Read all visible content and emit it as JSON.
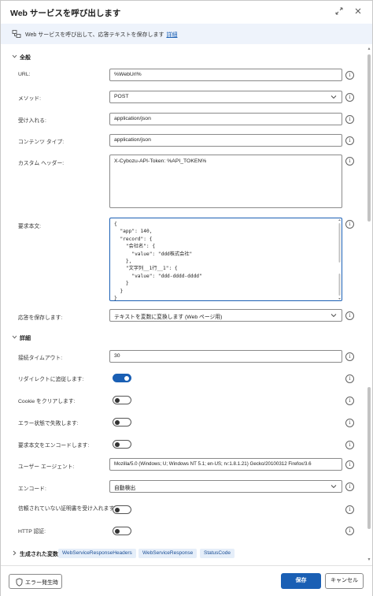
{
  "dialog": {
    "title": "Web サービスを呼び出します",
    "expand_icon": "expand-icon",
    "close_icon": "close-icon"
  },
  "info": {
    "text": "Web サービスを呼び出して、応答テキストを保存します",
    "link": "詳細"
  },
  "general": {
    "section_label": "全般",
    "url_label": "URL:",
    "url_value": "%WebUrl%",
    "method_label": "メソッド:",
    "method_value": "POST",
    "accept_label": "受け入れる:",
    "accept_value": "application/json",
    "content_type_label": "コンテンツ タイプ:",
    "content_type_value": "application/json",
    "custom_headers_label": "カスタム ヘッダー:",
    "custom_headers_value": "X-Cybozu-API-Token: %API_TOKEN%",
    "request_body_label": "要求本文:",
    "request_body_value": "{\n  \"app\": 140,\n  \"record\": {\n    \"会社名\": {\n      \"value\": \"ddd株式会社\"\n    },\n    \"文字列__1行__1\": {\n      \"value\": \"ddd-dddd-dddd\"\n    }\n  }\n}",
    "save_response_label": "応答を保存します:",
    "save_response_value": "テキストを変数に変換します (Web ページ用)"
  },
  "details": {
    "section_label": "詳細",
    "timeout_label": "接続タイムアウト:",
    "timeout_value": "30",
    "follow_redirect_label": "リダイレクトに追従します:",
    "follow_redirect_on": true,
    "clear_cookies_label": "Cookie をクリアします:",
    "clear_cookies_on": false,
    "fail_on_error_label": "エラー状態で失敗します:",
    "fail_on_error_on": false,
    "encode_body_label": "要求本文をエンコードします:",
    "encode_body_on": false,
    "user_agent_label": "ユーザー エージェント:",
    "user_agent_value": "Mozilla/5.0 (Windows; U; Windows NT 5.1; en-US; rv:1.8.1.21) Gecko/20100312 Firefox/3.6",
    "encoding_label": "エンコード:",
    "encoding_value": "自動検出",
    "untrusted_cert_label": "信頼されていない証明書を受け入れます:",
    "untrusted_cert_on": false,
    "http_auth_label": "HTTP 認証:",
    "http_auth_on": false
  },
  "variables": {
    "section_label": "生成された変数",
    "chips": [
      "WebServiceResponseHeaders",
      "WebServiceResponse",
      "StatusCode"
    ]
  },
  "footer": {
    "on_error_label": "エラー発生時",
    "save_label": "保存",
    "cancel_label": "キャンセル"
  },
  "colors": {
    "accent": "#1a5fb4",
    "info_bg": "#eef3fb",
    "chip_bg": "#e5eef9"
  }
}
